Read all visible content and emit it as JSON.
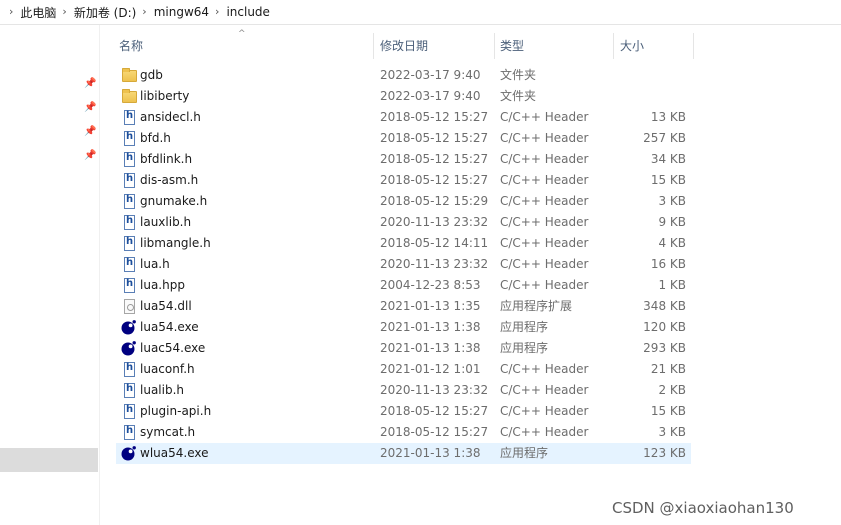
{
  "breadcrumb": {
    "items": [
      "此电脑",
      "新加卷 (D:)",
      "mingw64",
      "include"
    ],
    "separator": "›"
  },
  "columns": {
    "name": "名称",
    "modified": "修改日期",
    "type": "类型",
    "size": "大小"
  },
  "files": [
    {
      "name": "gdb",
      "modified": "2022-03-17 9:40",
      "type": "文件夹",
      "size": "",
      "icon": "folder-icon"
    },
    {
      "name": "libiberty",
      "modified": "2022-03-17 9:40",
      "type": "文件夹",
      "size": "",
      "icon": "folder-icon"
    },
    {
      "name": "ansidecl.h",
      "modified": "2018-05-12 15:27",
      "type": "C/C++ Header",
      "size": "13 KB",
      "icon": "header-file-icon"
    },
    {
      "name": "bfd.h",
      "modified": "2018-05-12 15:27",
      "type": "C/C++ Header",
      "size": "257 KB",
      "icon": "header-file-icon"
    },
    {
      "name": "bfdlink.h",
      "modified": "2018-05-12 15:27",
      "type": "C/C++ Header",
      "size": "34 KB",
      "icon": "header-file-icon"
    },
    {
      "name": "dis-asm.h",
      "modified": "2018-05-12 15:27",
      "type": "C/C++ Header",
      "size": "15 KB",
      "icon": "header-file-icon"
    },
    {
      "name": "gnumake.h",
      "modified": "2018-05-12 15:29",
      "type": "C/C++ Header",
      "size": "3 KB",
      "icon": "header-file-icon"
    },
    {
      "name": "lauxlib.h",
      "modified": "2020-11-13 23:32",
      "type": "C/C++ Header",
      "size": "9 KB",
      "icon": "header-file-icon"
    },
    {
      "name": "libmangle.h",
      "modified": "2018-05-12 14:11",
      "type": "C/C++ Header",
      "size": "4 KB",
      "icon": "header-file-icon"
    },
    {
      "name": "lua.h",
      "modified": "2020-11-13 23:32",
      "type": "C/C++ Header",
      "size": "16 KB",
      "icon": "header-file-icon"
    },
    {
      "name": "lua.hpp",
      "modified": "2004-12-23 8:53",
      "type": "C/C++ Header",
      "size": "1 KB",
      "icon": "header-file-icon"
    },
    {
      "name": "lua54.dll",
      "modified": "2021-01-13 1:35",
      "type": "应用程序扩展",
      "size": "348 KB",
      "icon": "dll-file-icon"
    },
    {
      "name": "lua54.exe",
      "modified": "2021-01-13 1:38",
      "type": "应用程序",
      "size": "120 KB",
      "icon": "lua-exe-icon"
    },
    {
      "name": "luac54.exe",
      "modified": "2021-01-13 1:38",
      "type": "应用程序",
      "size": "293 KB",
      "icon": "lua-exe-icon"
    },
    {
      "name": "luaconf.h",
      "modified": "2021-01-12 1:01",
      "type": "C/C++ Header",
      "size": "21 KB",
      "icon": "header-file-icon"
    },
    {
      "name": "lualib.h",
      "modified": "2020-11-13 23:32",
      "type": "C/C++ Header",
      "size": "2 KB",
      "icon": "header-file-icon"
    },
    {
      "name": "plugin-api.h",
      "modified": "2018-05-12 15:27",
      "type": "C/C++ Header",
      "size": "15 KB",
      "icon": "header-file-icon"
    },
    {
      "name": "symcat.h",
      "modified": "2018-05-12 15:27",
      "type": "C/C++ Header",
      "size": "3 KB",
      "icon": "header-file-icon"
    },
    {
      "name": "wlua54.exe",
      "modified": "2021-01-13 1:38",
      "type": "应用程序",
      "size": "123 KB",
      "icon": "lua-exe-icon"
    }
  ],
  "selected_file": "wlua54.exe",
  "watermark": "CSDN @xiaoxiaohan130",
  "colors": {
    "selection": "#e5f3ff",
    "header_text": "#4c607a",
    "folder": "#eec24f",
    "lua_icon": "#000080"
  }
}
